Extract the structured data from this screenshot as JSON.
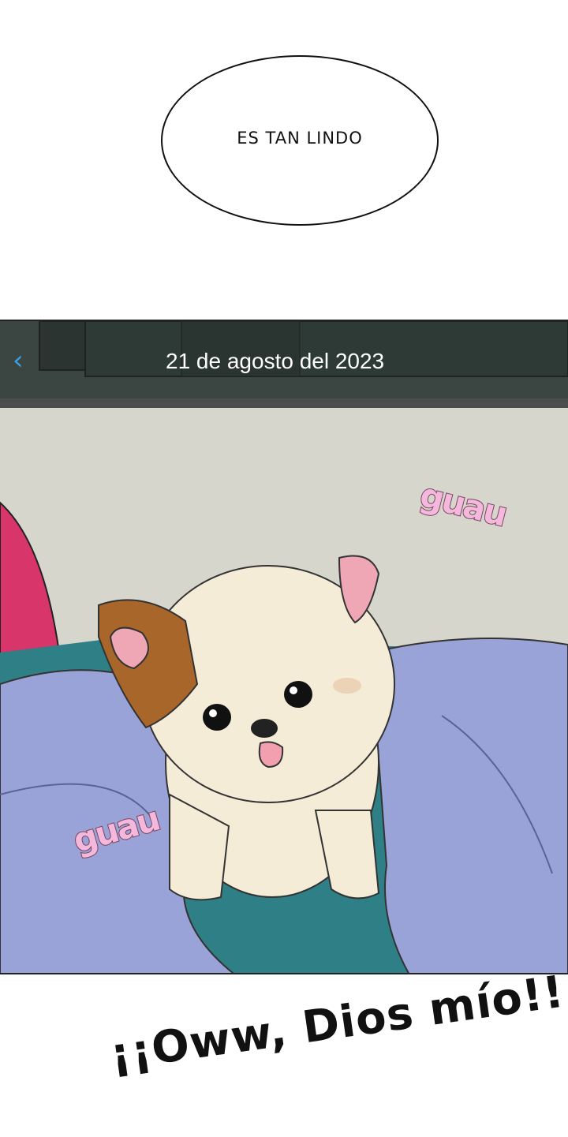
{
  "speech_bubble": {
    "text": "ES TAN LINDO"
  },
  "phone_screen": {
    "back_icon": "chevron-left-icon",
    "date_label": "21 de agosto del 2023"
  },
  "sound_effects": [
    {
      "text": "guau"
    },
    {
      "text": "guau"
    }
  ],
  "exclamation": {
    "text": "¡¡Oww, Dios mío!!"
  },
  "colors": {
    "wall": "#d6d6cc",
    "blanket": "#9aa3d8",
    "teal": "#2f7f87",
    "header": "#2e3a36",
    "sfx_fill": "#f4b8dc",
    "back_chevron": "#3aa0e6"
  }
}
